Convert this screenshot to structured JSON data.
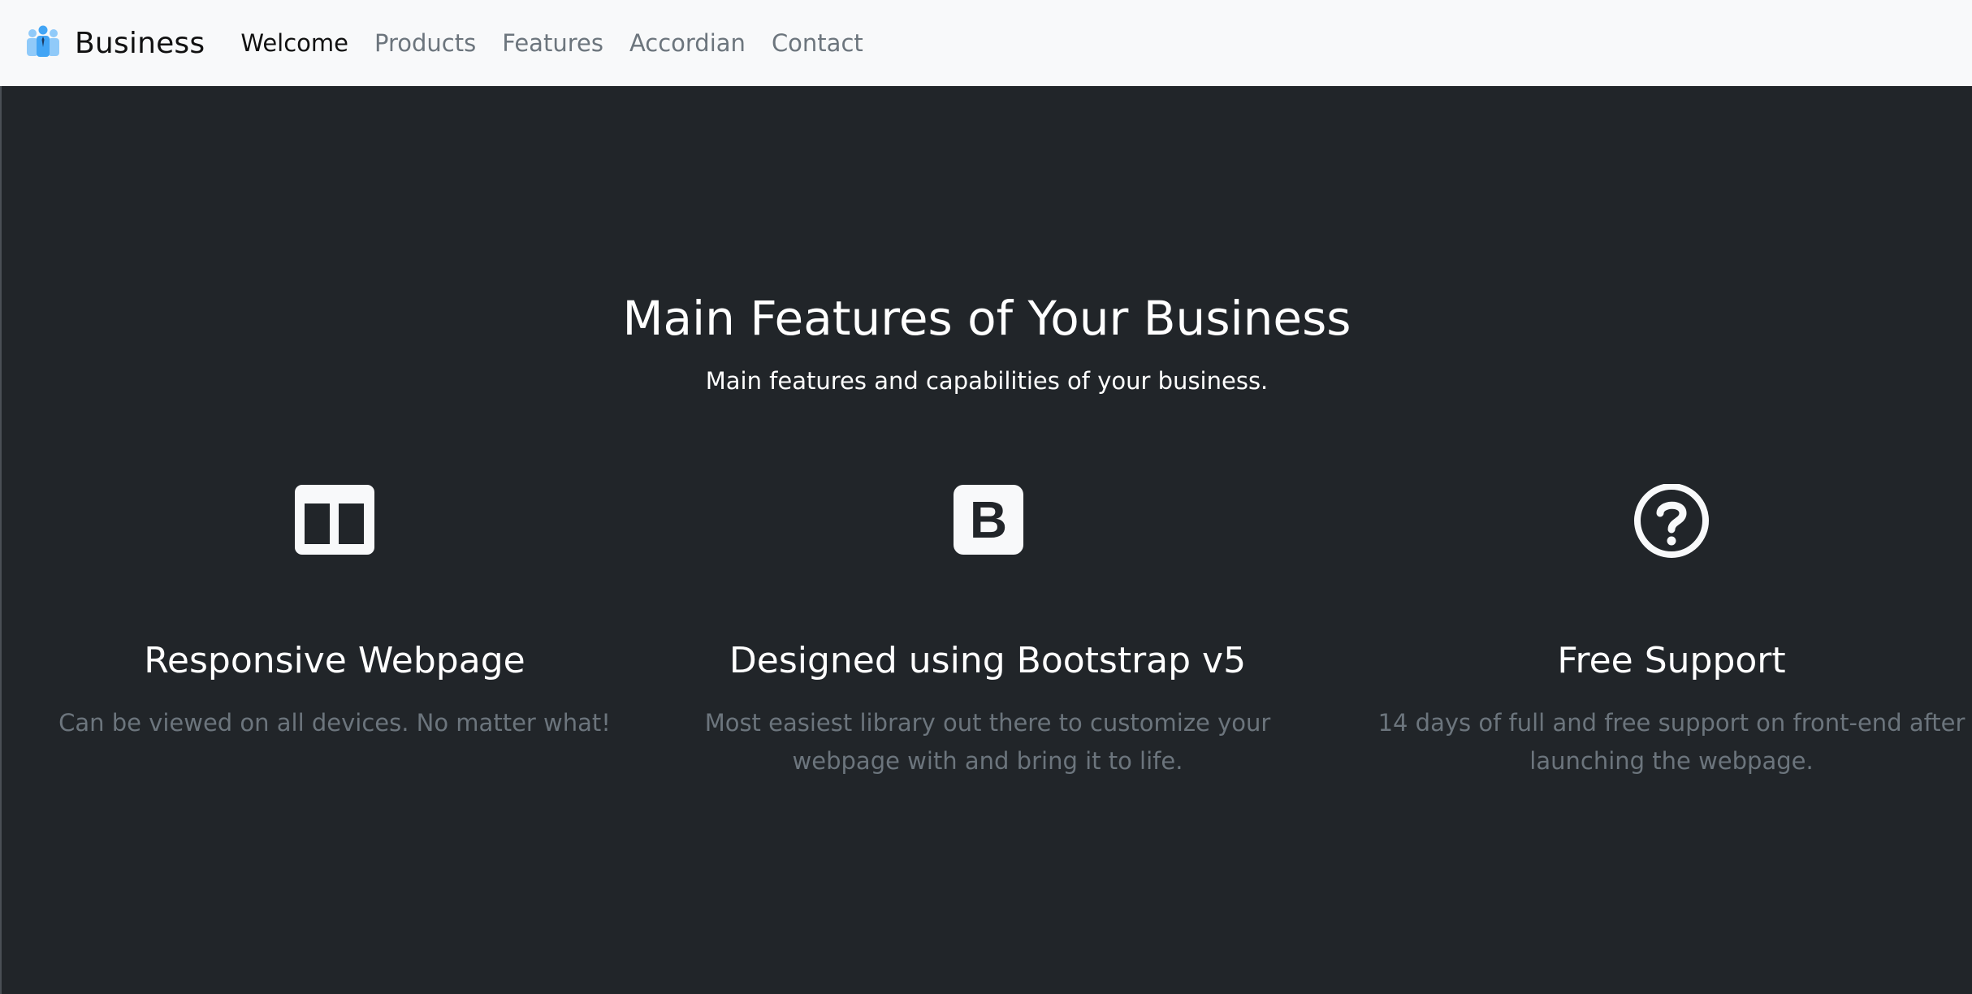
{
  "navbar": {
    "brand": {
      "text": "Business",
      "icon": "business-people-icon"
    },
    "links": [
      {
        "label": "Welcome",
        "active": true
      },
      {
        "label": "Products",
        "active": false
      },
      {
        "label": "Features",
        "active": false
      },
      {
        "label": "Accordian",
        "active": false
      },
      {
        "label": "Contact",
        "active": false
      }
    ]
  },
  "features": {
    "title": "Main Features of Your Business",
    "subtitle": "Main features and capabilities of your business.",
    "items": [
      {
        "icon": "layout-columns-icon",
        "title": "Responsive Webpage",
        "text": "Can be viewed on all devices. No matter what!"
      },
      {
        "icon": "bootstrap-icon",
        "title": "Designed using Bootstrap v5",
        "text": "Most easiest library out there to customize your webpage with and bring it to life."
      },
      {
        "icon": "question-circle-icon",
        "title": "Free Support",
        "text": "14 days of full and free support on front-end after launching the webpage."
      }
    ]
  },
  "colors": {
    "navbar_bg": "#f8f9fa",
    "section_bg": "#212529",
    "muted_text": "#6c757d",
    "heading_text": "#ffffff",
    "brand_icon": "#64b5f6"
  }
}
